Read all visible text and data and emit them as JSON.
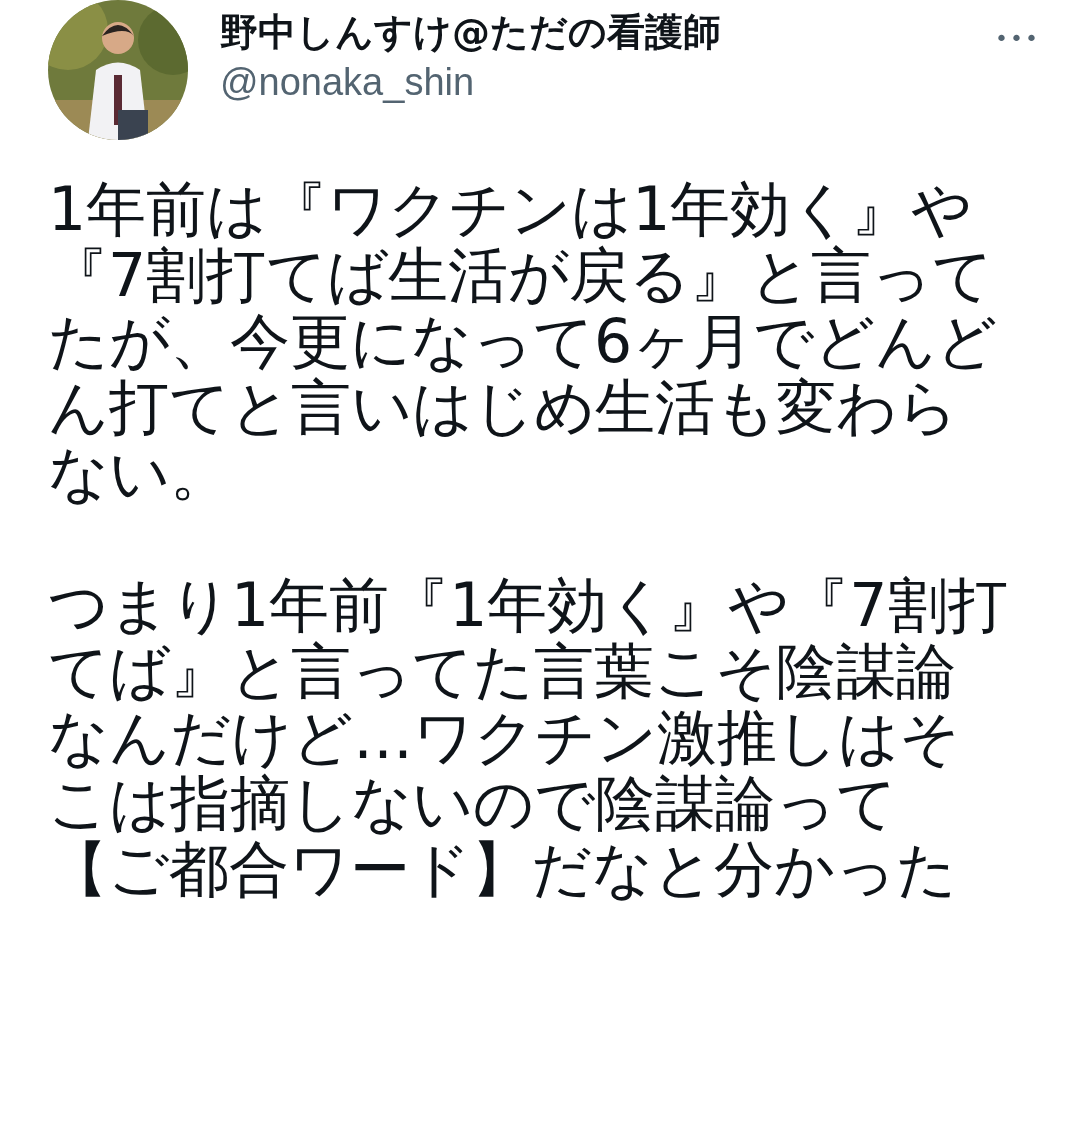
{
  "author": {
    "name": "野中しんすけ@ただの看護師",
    "handle": "@nonaka_shin"
  },
  "more_menu": "•••",
  "paragraphs": [
    "1年前は『ワクチンは1年効く』や『7割打てば生活が戻る』と言ってたが、今更になって6ヶ月でどんどん打てと言いはじめ生活も変わらない。",
    "つまり1年前『1年効く』や『7割打てば』と言ってた言葉こそ陰謀論なんだけど…ワクチン激推しはそこは指摘しないので陰謀論って【ご都合ワード】だなと分かった"
  ]
}
